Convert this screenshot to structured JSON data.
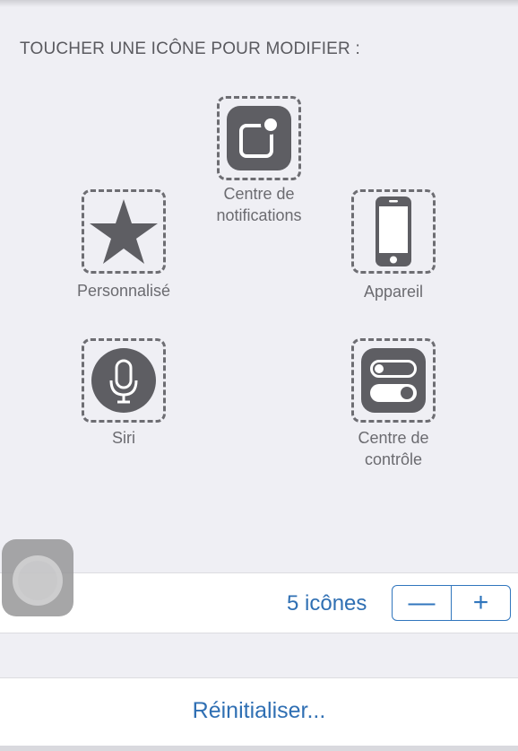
{
  "header": {
    "title": "TOUCHER UNE ICÔNE POUR MODIFIER :"
  },
  "icons": {
    "notifications": {
      "label_line1": "Centre de",
      "label_line2": "notifications",
      "icon": "notification-center-icon"
    },
    "custom": {
      "label": "Personnalisé",
      "icon": "star-icon"
    },
    "device": {
      "label": "Appareil",
      "icon": "iphone-icon"
    },
    "siri": {
      "label": "Siri",
      "icon": "microphone-icon"
    },
    "control_center": {
      "label_line1": "Centre de",
      "label_line2": "contrôle",
      "icon": "toggles-icon"
    }
  },
  "count": {
    "label": "5 icônes",
    "minus": "—",
    "plus": "+"
  },
  "reset": {
    "label": "Réinitialiser..."
  },
  "colors": {
    "accent": "#2f6fb3",
    "icon_fill": "#5e5e63",
    "background": "#efeff4"
  }
}
